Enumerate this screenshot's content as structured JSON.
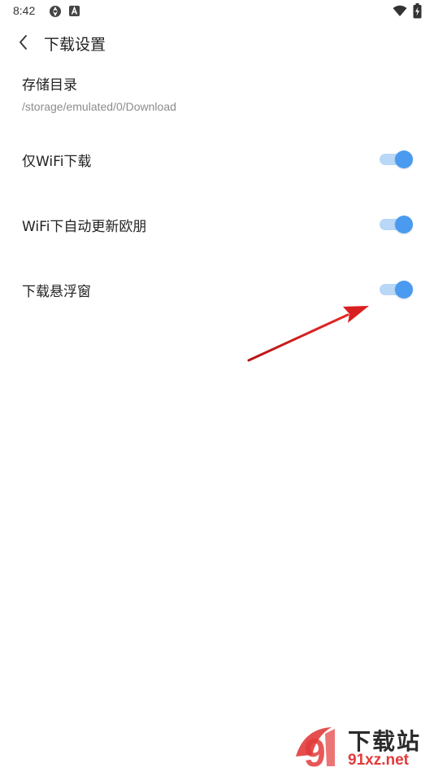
{
  "status_bar": {
    "time": "8:42",
    "icons": [
      "sync-icon",
      "notification-a-icon",
      "wifi-icon",
      "battery-charging-icon"
    ]
  },
  "header": {
    "title": "下载设置",
    "back_icon": "chevron-left-icon"
  },
  "storage": {
    "label": "存储目录",
    "path": "/storage/emulated/0/Download"
  },
  "settings": [
    {
      "label": "仅WiFi下载",
      "enabled": true
    },
    {
      "label": "WiFi下自动更新欧朋",
      "enabled": true
    },
    {
      "label": "下载悬浮窗",
      "enabled": true
    }
  ],
  "colors": {
    "toggle_on": "#4a9bf0",
    "toggle_track_on": "#b9d7f7",
    "annotation_arrow": "#d92020",
    "watermark_accent": "#e23b3b"
  },
  "watermark": {
    "title": "下载站",
    "domain": "91xz.net",
    "logo_text": "9"
  }
}
